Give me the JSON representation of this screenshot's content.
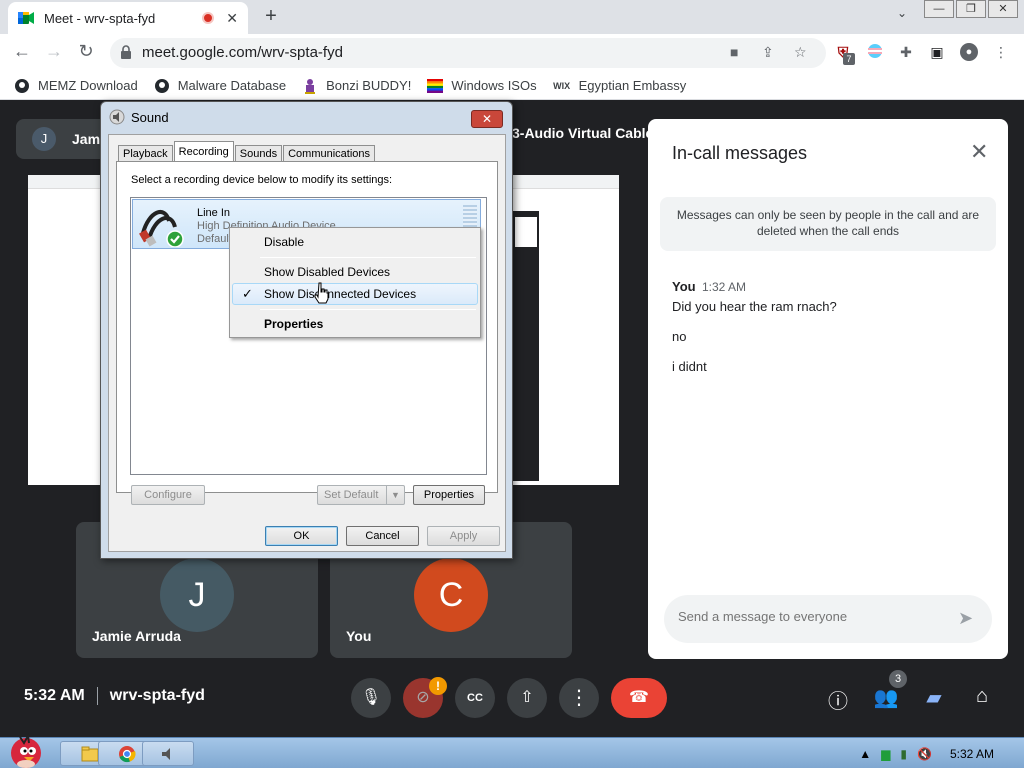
{
  "browser": {
    "tab_title": "Meet - wrv-spta-fyd",
    "url": "meet.google.com/wrv-spta-fyd",
    "extension_badge": "7",
    "bookmarks": [
      {
        "label": "MEMZ Download",
        "icon": "github-icon"
      },
      {
        "label": "Malware Database",
        "icon": "github-icon"
      },
      {
        "label": "Bonzi BUDDY!",
        "icon": "bonzi-icon"
      },
      {
        "label": "Windows ISOs",
        "icon": "rainbow-flag-icon"
      },
      {
        "label": "Egyptian Embassy",
        "icon": "wix-icon"
      }
    ],
    "wix_text": "WIX"
  },
  "meet": {
    "presenter_initial": "J",
    "presenter_name": "Jam",
    "shared_label": "3-Audio Virtual Cable",
    "participants": [
      {
        "initial": "J",
        "name": "Jamie Arruda",
        "color": "#455a64"
      },
      {
        "initial": "C",
        "name": "You",
        "color": "#d14a1e"
      }
    ],
    "time": "5:32 AM",
    "meeting_code": "wrv-spta-fyd",
    "cam_warning": "!",
    "people_count": "3"
  },
  "chat": {
    "title": "In-call messages",
    "notice": "Messages can only be seen by people in the call and are deleted when the call ends",
    "sender": "You",
    "sent_time": "1:32 AM",
    "messages": [
      "Did you hear the ram rnach?",
      "no",
      "i didnt"
    ],
    "input_placeholder": "Send a message to everyone"
  },
  "sound_dialog": {
    "title": "Sound",
    "tabs": [
      "Playback",
      "Recording",
      "Sounds",
      "Communications"
    ],
    "active_tab": "Recording",
    "instruction": "Select a recording device below to modify its settings:",
    "device": {
      "name": "Line In",
      "description": "High Definition Audio Device",
      "status": "Default Device"
    },
    "buttons": {
      "configure": "Configure",
      "set_default": "Set Default",
      "properties": "Properties",
      "ok": "OK",
      "cancel": "Cancel",
      "apply": "Apply"
    },
    "context_menu": {
      "disable": "Disable",
      "show_disabled": "Show Disabled Devices",
      "show_disconnected": "Show Disconnected Devices",
      "properties": "Properties"
    }
  },
  "taskbar": {
    "clock": "5:32 AM"
  }
}
